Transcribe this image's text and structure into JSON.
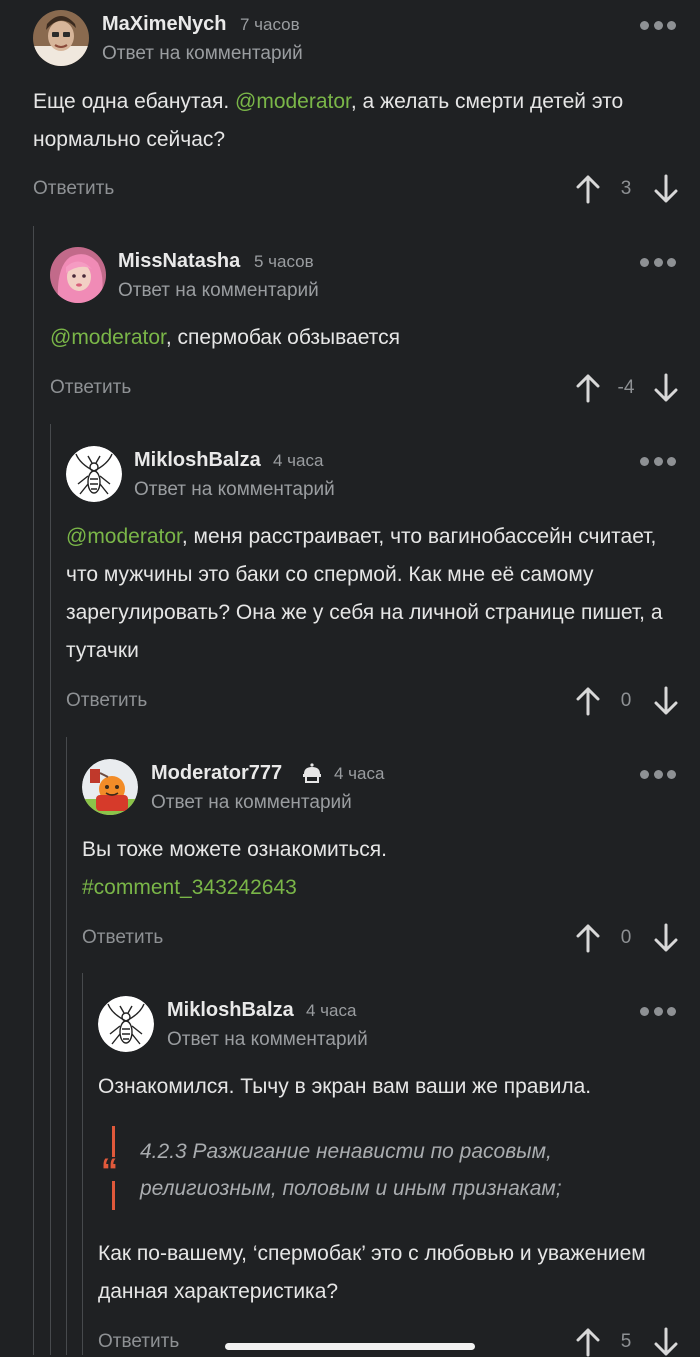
{
  "colors": {
    "background": "#1f2123",
    "mention": "#7ab648",
    "quote_accent": "#e0593b",
    "muted": "#9a9da0"
  },
  "comments": [
    {
      "username": "MaXimeNych",
      "time": "7 часов",
      "reply_note": "Ответ на комментарий",
      "text_pre": "Еще одна ебанутая. ",
      "mention": "@moderator",
      "text_post": ", а желать смерти детей это нормально сейчас?",
      "reply_label": "Ответить",
      "score": "3"
    },
    {
      "username": "MissNatasha",
      "time": "5 часов",
      "reply_note": "Ответ на комментарий",
      "mention": "@moderator",
      "text_post": ", спермобак обзывается",
      "reply_label": "Ответить",
      "score": "-4"
    },
    {
      "username": "MikloshBalza",
      "time": "4 часа",
      "reply_note": "Ответ на комментарий",
      "mention": "@moderator",
      "text_post": ", меня расстраивает, что вагинобассейн считает, что мужчины это баки со спермой. Как мне её самому зарегулировать? Она же у себя на личной странице пишет, а тутачки",
      "reply_label": "Ответить",
      "score": "0"
    },
    {
      "username": "Moderator777",
      "badge_icon": "moderator-cake-icon",
      "time": "4 часа",
      "reply_note": "Ответ на комментарий",
      "text_pre": "Вы тоже можете ознакомиться.",
      "link": "#comment_343242643",
      "reply_label": "Ответить",
      "score": "0"
    },
    {
      "username": "MikloshBalza",
      "time": "4 часа",
      "reply_note": "Ответ на комментарий",
      "text_pre": "Ознакомился. Тычу в экран вам ваши же правила.",
      "quote": "4.2.3 Разжигание ненависти по расовым, религиозным, половым и иным признакам;",
      "text_post": "Как по-вашему, ‘спермобак’ это с любовью и уважением данная характеристика?",
      "reply_label": "Ответить",
      "score": "5"
    }
  ]
}
